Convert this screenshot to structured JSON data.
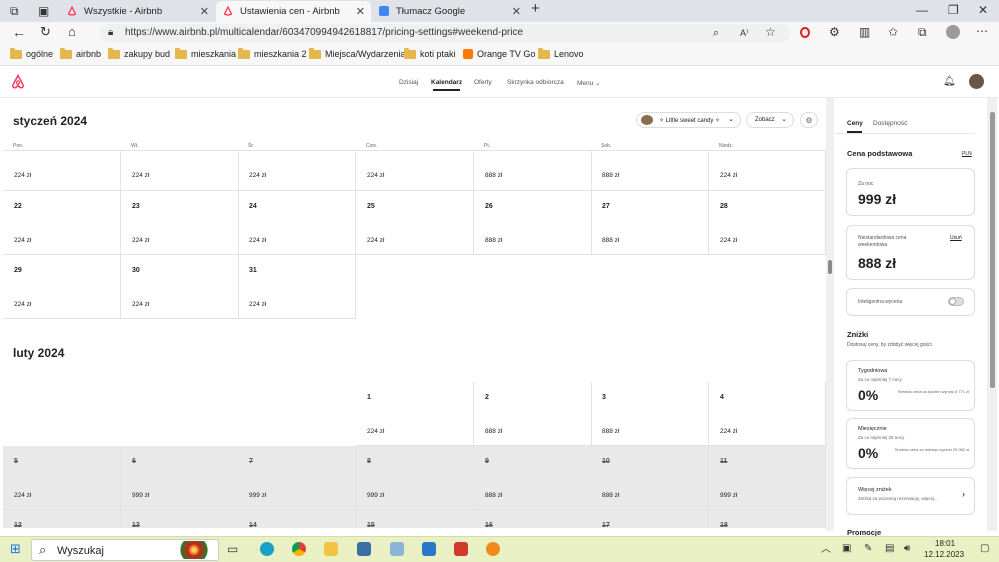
{
  "browser": {
    "tabs": [
      {
        "title": "Wszystkie - Airbnb",
        "active": false
      },
      {
        "title": "Ustawienia cen - Airbnb",
        "active": true
      },
      {
        "title": "Tłumacz Google",
        "active": false
      }
    ],
    "url": "https://www.airbnb.pl/multicalendar/603470994942618817/pricing-settings#weekend-price",
    "bookmarks": [
      "ogólne",
      "airbnb",
      "zakupy bud",
      "mieszkania",
      "mieszkania 2",
      "Miejsca/Wydarzenia",
      "koti ptaki",
      "Orange TV Go",
      "Lenovo"
    ]
  },
  "header": {
    "nav": [
      "Dzisiaj",
      "Kalendarz",
      "Oferty",
      "Skrzynka odbiorcza",
      "Menu"
    ],
    "active_nav": "Kalendarz"
  },
  "calendar": {
    "listing_label": "✧ Little sweet candy ✧",
    "view_label": "Zobacz",
    "weekdays": [
      "Pon.",
      "Wt.",
      "Śr.",
      "Czw.",
      "Pt.",
      "Sob.",
      "Niedz."
    ],
    "months": [
      {
        "title": "styczeń 2024",
        "rows": [
          [
            {
              "day": "",
              "price": "224 zł"
            },
            {
              "day": "",
              "price": "224 zł"
            },
            {
              "day": "",
              "price": "224 zł"
            },
            {
              "day": "",
              "price": "224 zł"
            },
            {
              "day": "",
              "price": "888 zł"
            },
            {
              "day": "",
              "price": "888 zł"
            },
            {
              "day": "",
              "price": "224 zł"
            }
          ],
          [
            {
              "day": "22",
              "price": "224 zł"
            },
            {
              "day": "23",
              "price": "224 zł"
            },
            {
              "day": "24",
              "price": "224 zł"
            },
            {
              "day": "25",
              "price": "224 zł"
            },
            {
              "day": "26",
              "price": "888 zł"
            },
            {
              "day": "27",
              "price": "888 zł"
            },
            {
              "day": "28",
              "price": "224 zł"
            }
          ],
          [
            {
              "day": "29",
              "price": "224 zł"
            },
            {
              "day": "30",
              "price": "224 zł"
            },
            {
              "day": "31",
              "price": "224 zł"
            }
          ]
        ]
      },
      {
        "title": "luty 2024",
        "rows": [
          [
            null,
            null,
            null,
            {
              "day": "1",
              "price": "224 zł"
            },
            {
              "day": "2",
              "price": "888 zł"
            },
            {
              "day": "3",
              "price": "888 zł"
            },
            {
              "day": "4",
              "price": "224 zł"
            }
          ],
          [
            {
              "day": "5",
              "price": "224 zł",
              "past": true
            },
            {
              "day": "6",
              "price": "999 zł",
              "past": true
            },
            {
              "day": "7",
              "price": "999 zł",
              "past": true
            },
            {
              "day": "8",
              "price": "999 zł",
              "past": true
            },
            {
              "day": "9",
              "price": "888 zł",
              "past": true
            },
            {
              "day": "10",
              "price": "888 zł",
              "past": true
            },
            {
              "day": "11",
              "price": "999 zł",
              "past": true
            }
          ],
          [
            {
              "day": "12",
              "price": "",
              "past": true
            },
            {
              "day": "13",
              "price": "",
              "past": true
            },
            {
              "day": "14",
              "price": "",
              "past": true
            },
            {
              "day": "15",
              "price": "",
              "past": true
            },
            {
              "day": "16",
              "price": "",
              "past": true
            },
            {
              "day": "17",
              "price": "",
              "past": true
            },
            {
              "day": "18",
              "price": "",
              "past": true
            }
          ]
        ]
      }
    ]
  },
  "panel": {
    "tabs": [
      "Ceny",
      "Dostępność"
    ],
    "base_heading": "Cena podstawowa",
    "currency": "PLN",
    "per_night_label": "Za noc",
    "per_night_value": "999 zł",
    "weekend_label": "Niestandardowa cena weekendowa",
    "remove_label": "Usuń",
    "weekend_value": "888 zł",
    "smart_label": "Inteligentna wycena",
    "discounts_heading": "Zniżki",
    "discounts_sub": "Dostosuj ceny, by zdobyć więcej gości.",
    "weekly_title": "Tygodniowa",
    "weekly_sub": "Za co najmniej 7 nocy",
    "weekly_value": "0%",
    "weekly_note": "Średnia cena za tydzień wynosi 6 771 zł",
    "monthly_title": "Miesięcznie",
    "monthly_sub": "Za co najmniej 28 nocy",
    "monthly_value": "0%",
    "monthly_note": "Średnia cena za miesiąc wynosi 29 082 zł",
    "more_title": "Więcej zniżek",
    "more_sub": "Zniżka za wczesną rezerwację, więcej...",
    "promo_heading": "Promocje"
  },
  "taskbar": {
    "search_placeholder": "Wyszukaj",
    "time": "18:01",
    "date": "12.12.2023"
  },
  "colors": {
    "airbnb": "#ff385c",
    "tabbar": "#dfe3e7",
    "taskbar": "#e8f0c4",
    "folder": "#e6b84c"
  }
}
